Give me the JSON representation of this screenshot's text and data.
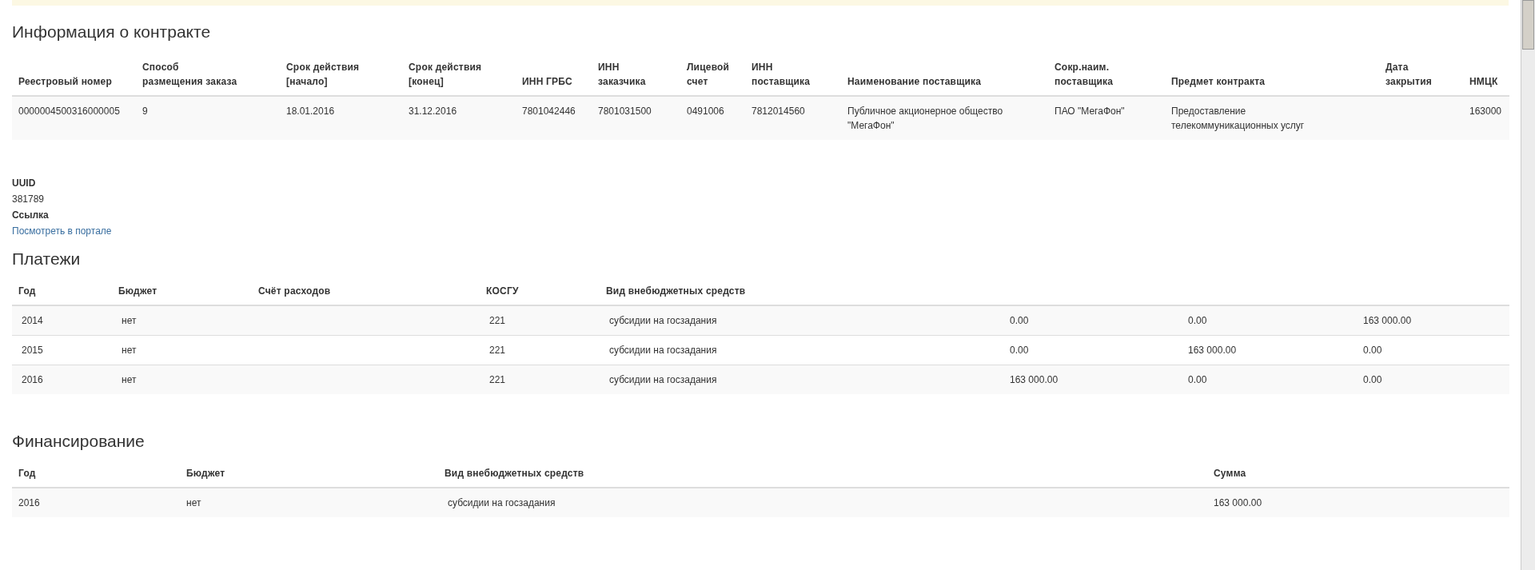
{
  "contract": {
    "title": "Информация о контракте",
    "columns": [
      "Реестровый номер",
      "Способ размещения заказа",
      "Срок действия [начало]",
      "Срок действия [конец]",
      "ИНН ГРБС",
      "ИНН заказчика",
      "Лицевой счет",
      "ИНН поставщика",
      "Наименование поставщика",
      "Сокр.наим. поставщика",
      "Предмет контракта",
      "Дата закрытия",
      "НМЦК"
    ],
    "rows": [
      [
        "0000004500316000005",
        "9",
        "18.01.2016",
        "31.12.2016",
        "7801042446",
        "7801031500",
        "0491006",
        "7812014560",
        "Публичное акционерное общество \"МегаФон\"",
        "ПАО \"МегаФон\"",
        "Предоставление телекоммуникационных услуг",
        null,
        "163000"
      ]
    ]
  },
  "details": [
    {
      "label": "UUID",
      "value": "381789",
      "kind": "text"
    },
    {
      "label": "Ссылка",
      "value": "Посмотреть в портале",
      "kind": "link"
    }
  ],
  "payments": {
    "title": "Платежи",
    "columns": [
      "Год",
      "Бюджет",
      "Счёт расходов",
      "КОСГУ",
      "Вид внебюджетных средств",
      null,
      null,
      null
    ],
    "rows": [
      [
        "2014",
        "нет",
        null,
        "221",
        "субсидии на госзадания",
        "0.00",
        "0.00",
        "163 000.00"
      ],
      [
        "2015",
        "нет",
        null,
        "221",
        "субсидии на госзадания",
        "0.00",
        "163 000.00",
        "0.00"
      ],
      [
        "2016",
        "нет",
        null,
        "221",
        "субсидии на госзадания",
        "163 000.00",
        "0.00",
        "0.00"
      ]
    ]
  },
  "financing": {
    "title": "Финансирование",
    "columns": [
      "Год",
      "Бюджет",
      "Вид внебюджетных средств",
      "Сумма"
    ],
    "rows": [
      [
        "2016",
        "нет",
        "субсидии на госзадания",
        "163 000.00"
      ]
    ]
  }
}
